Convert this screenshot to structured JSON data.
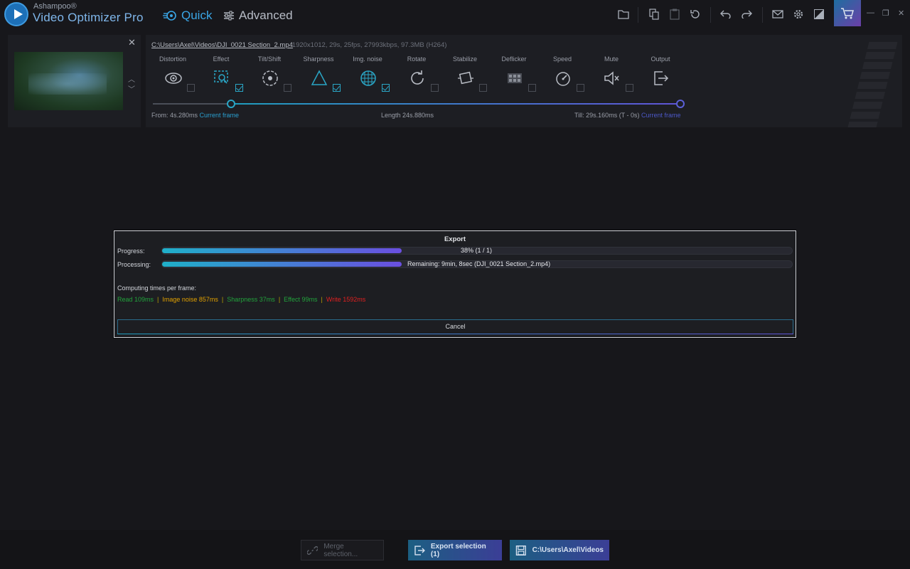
{
  "app": {
    "brand_small": "Ashampoo®",
    "brand_name": "Video Optimizer Pro"
  },
  "modes": {
    "quick": "Quick",
    "advanced": "Advanced"
  },
  "clip": {
    "path": "C:\\Users\\Axel\\Videos\\DJI_0021 Section_2.mp4",
    "meta": "-   1920x1012, 29s, 25fps, 27993kbps, 97.3MB (H264)",
    "close_glyph": "✕",
    "filters": [
      {
        "label": "Distortion",
        "checked": false
      },
      {
        "label": "Effect",
        "checked": true
      },
      {
        "label": "Tilt/Shift",
        "checked": false
      },
      {
        "label": "Sharpness",
        "checked": true
      },
      {
        "label": "Img. noise",
        "checked": true
      },
      {
        "label": "Rotate",
        "checked": false
      },
      {
        "label": "Stabilize",
        "checked": false
      },
      {
        "label": "Deflicker",
        "checked": false
      },
      {
        "label": "Speed",
        "checked": false
      },
      {
        "label": "Mute",
        "checked": false
      },
      {
        "label": "Output"
      }
    ],
    "range": {
      "from_label": "From: 4s.280ms",
      "from_link": "Current frame",
      "length": "Length  24s.880ms",
      "till_label": "Till:  29s.160ms (T - 0s)",
      "till_link": "Current frame",
      "start_fraction": 0.148,
      "end_fraction": 1.0
    }
  },
  "dialog": {
    "title": "Export",
    "progress_label": "Progress:",
    "progress_text": "38% (1 / 1)",
    "progress_fraction": 0.38,
    "processing_label": "Processing:",
    "processing_text": "Remaining: 9min, 8sec (DJI_0021 Section_2.mp4)",
    "processing_fraction": 0.38,
    "computing_label": "Computing times per frame:",
    "times": [
      {
        "text": "Read 109ms",
        "color": "#22a33c"
      },
      {
        "text": "Image noise 857ms",
        "color": "#e0a000"
      },
      {
        "text": "Sharpness 37ms",
        "color": "#22a33c"
      },
      {
        "text": "Effect 99ms",
        "color": "#22a33c"
      },
      {
        "text": "Write 1592ms",
        "color": "#e02020"
      }
    ],
    "separator": "|",
    "cancel_label": "Cancel"
  },
  "bottom": {
    "merge_label": "Merge selection...",
    "export_label": "Export selection (1)",
    "save_label": "C:\\Users\\Axel\\Videos"
  },
  "colors": {
    "accent_cyan": "#2aa6c6",
    "accent_purple": "#5f54d6"
  }
}
